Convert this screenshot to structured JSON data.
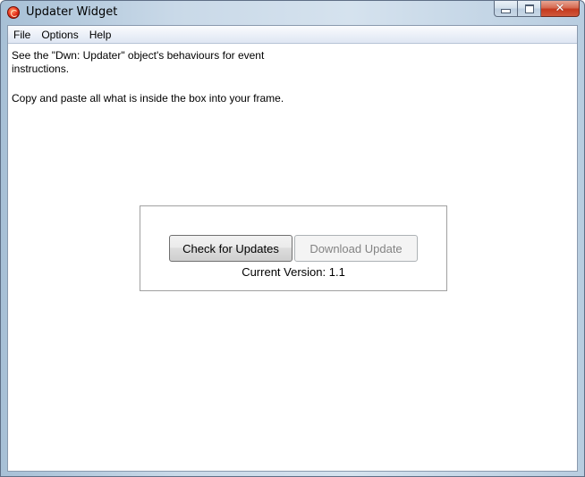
{
  "window": {
    "title": "Updater Widget"
  },
  "menu": {
    "items": [
      {
        "label": "File"
      },
      {
        "label": "Options"
      },
      {
        "label": "Help"
      }
    ]
  },
  "content": {
    "instruction_1": "See the \"Dwn: Updater\" object's behaviours for event\ninstructions.",
    "instruction_2": "Copy and paste all what is inside the box into your frame."
  },
  "updater": {
    "check_label": "Check for Updates",
    "download_label": "Download Update",
    "version_text": "Current Version: 1.1"
  },
  "icons": {
    "app": "updater-app-icon",
    "minimize": "minimize-icon",
    "maximize": "maximize-icon",
    "close": "close-icon"
  },
  "colors": {
    "disabled_text": "#838383",
    "close_button": "#c4391e"
  }
}
